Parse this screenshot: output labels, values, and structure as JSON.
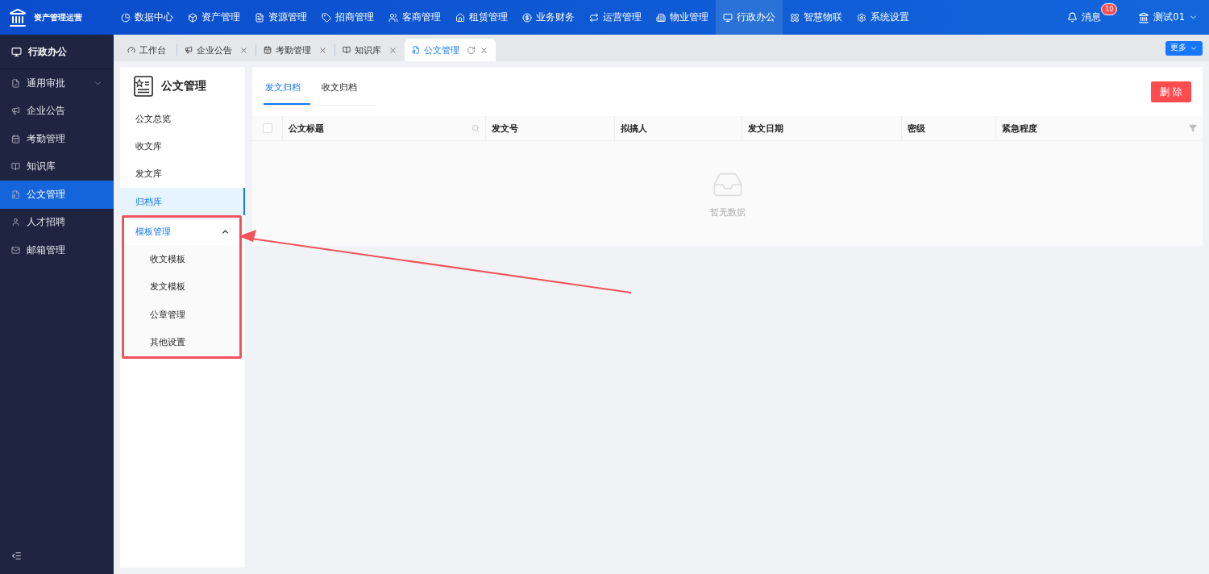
{
  "app": {
    "title": "资产管理运营"
  },
  "top_nav": [
    {
      "label": "数据中心",
      "selected": false
    },
    {
      "label": "资产管理",
      "selected": false
    },
    {
      "label": "资源管理",
      "selected": false
    },
    {
      "label": "招商管理",
      "selected": false
    },
    {
      "label": "客商管理",
      "selected": false
    },
    {
      "label": "租赁管理",
      "selected": false
    },
    {
      "label": "业务财务",
      "selected": false
    },
    {
      "label": "运营管理",
      "selected": false
    },
    {
      "label": "物业管理",
      "selected": false
    },
    {
      "label": "行政办公",
      "selected": true
    },
    {
      "label": "智慧物联",
      "selected": false
    },
    {
      "label": "系统设置",
      "selected": false
    }
  ],
  "header": {
    "messages": {
      "label": "消息",
      "badge": "10"
    },
    "user": "测试01"
  },
  "sidebar": {
    "title": "行政办公",
    "items": [
      {
        "label": "通用审批",
        "selected": false,
        "has_children": true
      },
      {
        "label": "企业公告",
        "selected": false,
        "has_children": false
      },
      {
        "label": "考勤管理",
        "selected": false,
        "has_children": false
      },
      {
        "label": "知识库",
        "selected": false,
        "has_children": false
      },
      {
        "label": "公文管理",
        "selected": true,
        "has_children": false
      },
      {
        "label": "人才招聘",
        "selected": false,
        "has_children": false
      },
      {
        "label": "邮箱管理",
        "selected": false,
        "has_children": false
      }
    ]
  },
  "tabs": [
    {
      "label": "工作台",
      "selected": false,
      "closable": false
    },
    {
      "label": "企业公告",
      "selected": false,
      "closable": true
    },
    {
      "label": "考勤管理",
      "selected": false,
      "closable": true
    },
    {
      "label": "知识库",
      "selected": false,
      "closable": true
    },
    {
      "label": "公文管理",
      "selected": true,
      "closable": true
    }
  ],
  "more_button": "更多",
  "module": {
    "title": "公文管理",
    "items": [
      {
        "label": "公文总览",
        "selected": false
      },
      {
        "label": "收文库",
        "selected": false
      },
      {
        "label": "发文库",
        "selected": false
      },
      {
        "label": "归档库",
        "selected": true
      },
      {
        "label": "模板管理",
        "selected": false,
        "expanded": true,
        "highlighted": true,
        "children": [
          {
            "label": "收文模板",
            "selected": false
          },
          {
            "label": "发文模板",
            "selected": false
          },
          {
            "label": "公章管理",
            "selected": false
          },
          {
            "label": "其他设置",
            "selected": false
          }
        ]
      }
    ]
  },
  "archive_tabs": [
    {
      "label": "发文归档",
      "selected": true
    },
    {
      "label": "收文归档",
      "selected": false
    }
  ],
  "delete_button": "删 除",
  "table": {
    "all_checked": false,
    "columns": [
      {
        "label": "公文标题",
        "kind": "searchable"
      },
      {
        "label": "发文号",
        "kind": "plain"
      },
      {
        "label": "拟搞人",
        "kind": "plain"
      },
      {
        "label": "发文日期",
        "kind": "plain"
      },
      {
        "label": "密级",
        "kind": "plain"
      },
      {
        "label": "紧急程度",
        "kind": "filterable"
      }
    ],
    "empty_text": "暂无数据"
  }
}
